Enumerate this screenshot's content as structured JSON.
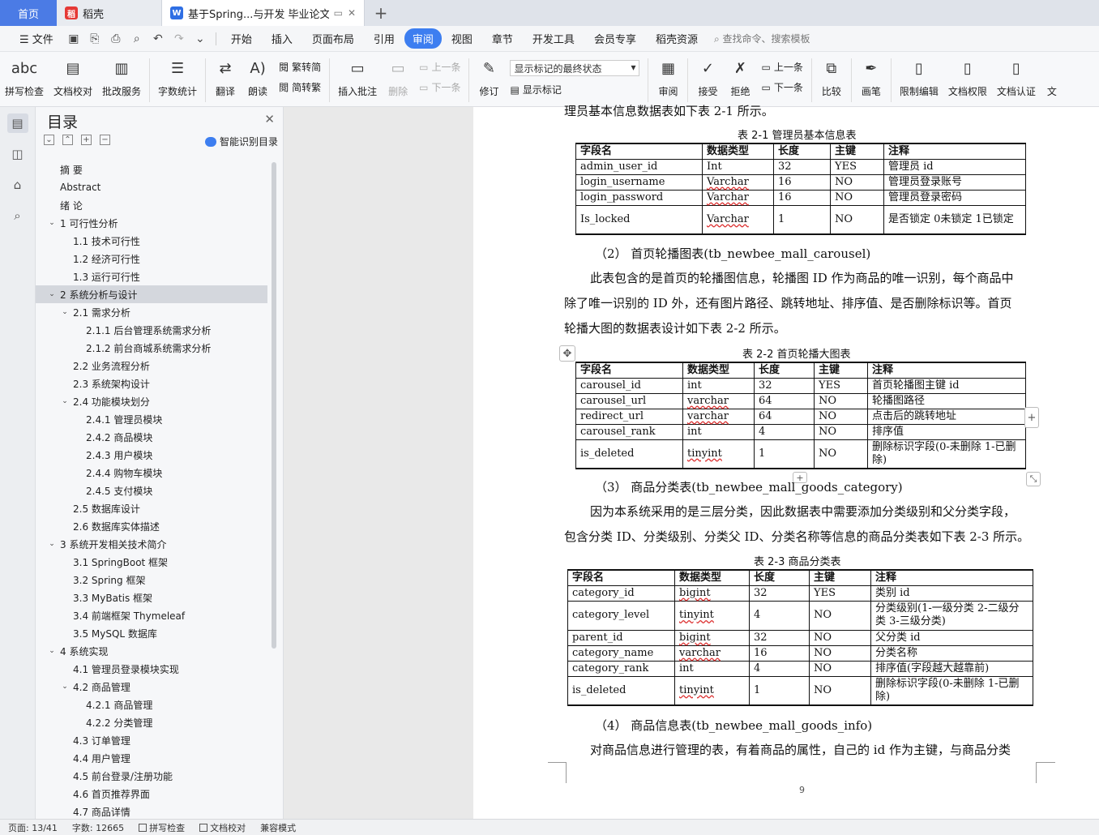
{
  "tabs": {
    "home": "首页",
    "daoke": "稻壳",
    "doc_title": "基于Spring...与开发 毕业论文"
  },
  "menu": {
    "file": "文件",
    "items": [
      "开始",
      "插入",
      "页面布局",
      "引用",
      "审阅",
      "视图",
      "章节",
      "开发工具",
      "会员专享",
      "稻壳资源"
    ],
    "search": "查找命令、搜索模板"
  },
  "ribbon": {
    "spell": "拼写检查",
    "proof": "文档校对",
    "review_service": "批改服务",
    "word_count": "字数统计",
    "translate": "翻译",
    "read_aloud": "朗读",
    "trad": "繁转简",
    "simp": "简转繁",
    "insert_comment": "插入批注",
    "delete": "删除",
    "prev": "上一条",
    "next": "下一条",
    "revise": "修订",
    "markup_state": "显示标记的最终状态",
    "show_markup": "显示标记",
    "review_pane": "审阅",
    "accept": "接受",
    "reject": "拒绝",
    "prev2": "上一条",
    "next2": "下一条",
    "compare": "比较",
    "ink": "画笔",
    "restrict": "限制编辑",
    "permission": "文档权限",
    "certify": "文档认证",
    "cut_text": "文"
  },
  "toc": {
    "title": "目录",
    "ai": "智能识别目录",
    "items": [
      {
        "label": "摘  要",
        "level": 0,
        "arrow": ""
      },
      {
        "label": "Abstract",
        "level": 0,
        "arrow": ""
      },
      {
        "label": "绪  论",
        "level": 0,
        "arrow": ""
      },
      {
        "label": "1  可行性分析",
        "level": 0,
        "arrow": "v"
      },
      {
        "label": "1.1  技术可行性",
        "level": 1,
        "arrow": ""
      },
      {
        "label": "1.2  经济可行性",
        "level": 1,
        "arrow": ""
      },
      {
        "label": "1.3  运行可行性",
        "level": 1,
        "arrow": ""
      },
      {
        "label": "2  系统分析与设计",
        "level": 0,
        "arrow": "v",
        "selected": true
      },
      {
        "label": "2.1  需求分析",
        "level": 1,
        "arrow": "v"
      },
      {
        "label": "2.1.1  后台管理系统需求分析",
        "level": 2,
        "arrow": ""
      },
      {
        "label": "2.1.2  前台商城系统需求分析",
        "level": 2,
        "arrow": ""
      },
      {
        "label": "2.2  业务流程分析",
        "level": 1,
        "arrow": ""
      },
      {
        "label": "2.3  系统架构设计",
        "level": 1,
        "arrow": ""
      },
      {
        "label": "2.4  功能模块划分",
        "level": 1,
        "arrow": "v"
      },
      {
        "label": "2.4.1  管理员模块",
        "level": 2,
        "arrow": ""
      },
      {
        "label": "2.4.2  商品模块",
        "level": 2,
        "arrow": ""
      },
      {
        "label": "2.4.3  用户模块",
        "level": 2,
        "arrow": ""
      },
      {
        "label": "2.4.4  购物车模块",
        "level": 2,
        "arrow": ""
      },
      {
        "label": "2.4.5  支付模块",
        "level": 2,
        "arrow": ""
      },
      {
        "label": "2.5  数据库设计",
        "level": 1,
        "arrow": ""
      },
      {
        "label": "2.6  数据库实体描述",
        "level": 1,
        "arrow": ""
      },
      {
        "label": "3  系统开发相关技术简介",
        "level": 0,
        "arrow": "v"
      },
      {
        "label": "3.1 SpringBoot 框架",
        "level": 1,
        "arrow": ""
      },
      {
        "label": "3.2 Spring 框架",
        "level": 1,
        "arrow": ""
      },
      {
        "label": "3.3 MyBatis 框架",
        "level": 1,
        "arrow": ""
      },
      {
        "label": "3.4  前端框架 Thymeleaf",
        "level": 1,
        "arrow": ""
      },
      {
        "label": "3.5 MySQL 数据库",
        "level": 1,
        "arrow": ""
      },
      {
        "label": "4  系统实现",
        "level": 0,
        "arrow": "v"
      },
      {
        "label": "4.1  管理员登录模块实现",
        "level": 1,
        "arrow": ""
      },
      {
        "label": "4.2  商品管理",
        "level": 1,
        "arrow": "v"
      },
      {
        "label": "4.2.1  商品管理",
        "level": 2,
        "arrow": ""
      },
      {
        "label": "4.2.2  分类管理",
        "level": 2,
        "arrow": ""
      },
      {
        "label": "4.3  订单管理",
        "level": 1,
        "arrow": ""
      },
      {
        "label": "4.4  用户管理",
        "level": 1,
        "arrow": ""
      },
      {
        "label": "4.5  前台登录/注册功能",
        "level": 1,
        "arrow": ""
      },
      {
        "label": "4.6  首页推荐界面",
        "level": 1,
        "arrow": ""
      },
      {
        "label": "4.7  商品详情",
        "level": 1,
        "arrow": ""
      }
    ]
  },
  "doc": {
    "top_line": "理员基本信息数据表如下表  2-1  所示。",
    "t1_caption": "表 2-1  管理员基本信息表",
    "t2_heading": "（2）  首页轮播图表(tb_newbee_mall_carousel)",
    "p2_1": "此表包含的是首页的轮播图信息，轮播图 ID 作为商品的唯一识别，每个商品中",
    "p2_2": "除了唯一识别的 ID 外，还有图片路径、跳转地址、排序值、是否删除标识等。首页",
    "p2_3": "轮播大图的数据表设计如下表  2-2  所示。",
    "t2_caption": "表 2-2  首页轮播大图表",
    "t3_heading": "（3）  商品分类表(tb_newbee_mall_goods_category)",
    "p3_1": "因为本系统采用的是三层分类，因此数据表中需要添加分类级别和父分类字段，",
    "p3_2": "包含分类 ID、分类级别、分类父 ID、分类名称等信息的商品分类表如下表 2-3 所示。",
    "t3_caption": "表 2-3  商品分类表",
    "t4_heading": "（4）  商品信息表(tb_newbee_mall_goods_info)",
    "p4_1": "对商品信息进行管理的表，有着商品的属性，自己的 id 作为主键，与商品分类",
    "page_number": "9"
  },
  "tables": {
    "headers": [
      "字段名",
      "数据类型",
      "长度",
      "主键",
      "注释"
    ],
    "t1": [
      [
        "admin_user_id",
        "Int",
        "32",
        "YES",
        "管理员 id"
      ],
      [
        "login_username",
        "Varchar",
        "16",
        "NO",
        "管理员登录账号"
      ],
      [
        "login_password",
        "Varchar",
        "16",
        "NO",
        "管理员登录密码"
      ],
      [
        "Is_locked",
        "Varchar",
        "1",
        "NO",
        "是否锁定  0未锁定  1已锁定"
      ]
    ],
    "t2": [
      [
        "carousel_id",
        "int",
        "32",
        "YES",
        "首页轮播图主键 id"
      ],
      [
        "carousel_url",
        "varchar",
        "64",
        "NO",
        "轮播图路径"
      ],
      [
        "redirect_url",
        "varchar",
        "64",
        "NO",
        "点击后的跳转地址"
      ],
      [
        "carousel_rank",
        "int",
        "4",
        "NO",
        "排序值"
      ],
      [
        "is_deleted",
        "tinyint",
        "1",
        "NO",
        "删除标识字段(0-未删除  1-已删除)"
      ]
    ],
    "t3": [
      [
        "category_id",
        "bigint",
        "32",
        "YES",
        "类别 id"
      ],
      [
        "category_level",
        "tinyint",
        "4",
        "NO",
        "分类级别(1-一级分类  2-二级分类  3-三级分类)"
      ],
      [
        "parent_id",
        "bigint",
        "32",
        "NO",
        "父分类 id"
      ],
      [
        "category_name",
        "varchar",
        "16",
        "NO",
        "分类名称"
      ],
      [
        "category_rank",
        "int",
        "4",
        "NO",
        "排序值(字段越大越靠前)"
      ],
      [
        "is_deleted",
        "tinyint",
        "1",
        "NO",
        "删除标识字段(0-未删除  1-已删除)"
      ]
    ]
  },
  "status": {
    "page": "页面: 13/41",
    "words": "字数: 12665",
    "spell": "拼写检查",
    "proof": "文档校对",
    "compat": "兼容模式"
  }
}
